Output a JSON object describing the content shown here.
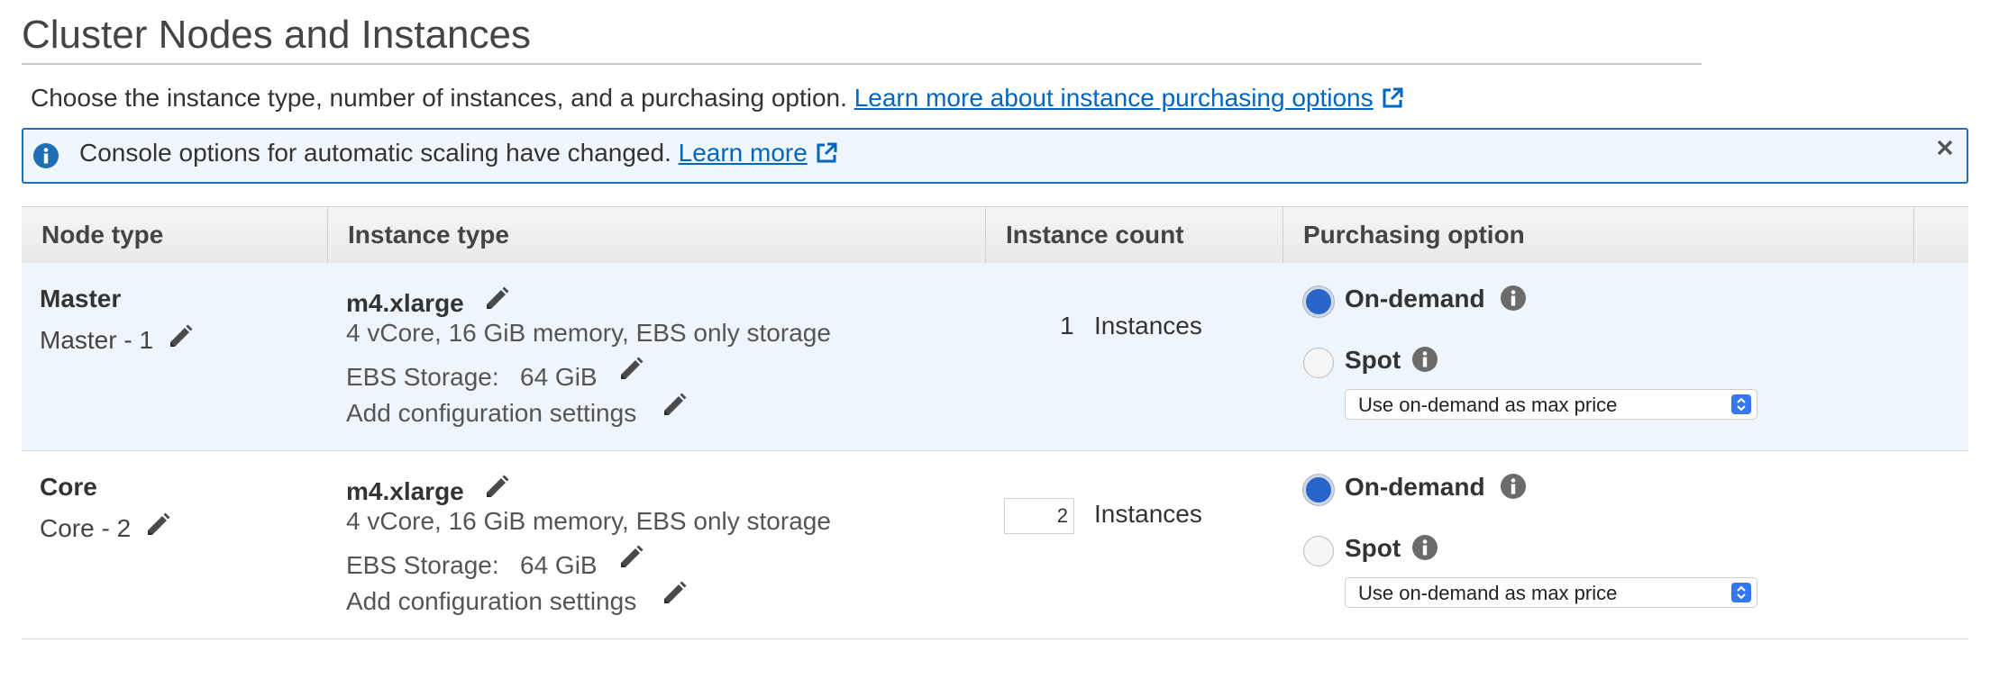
{
  "page": {
    "title": "Cluster Nodes and Instances",
    "description": "Choose the instance type, number of instances, and a purchasing option.",
    "description_link": "Learn more about instance purchasing options"
  },
  "info": {
    "text": "Console options for automatic scaling have changed.",
    "link": "Learn more"
  },
  "table": {
    "headers": [
      "Node type",
      "Instance type",
      "Instance count",
      "Purchasing option"
    ],
    "rows": [
      {
        "node_type": "Master",
        "node_name": "Master - 1",
        "instance_type": "m4.xlarge",
        "spec": "4 vCore, 16 GiB memory, EBS only storage",
        "ebs_label": "EBS Storage:",
        "ebs_value": "64 GiB",
        "config_label": "Add configuration settings",
        "count": "1",
        "count_unit": "Instances",
        "on_demand": "On-demand",
        "spot": "Spot",
        "max_price": "Use on-demand as max price"
      },
      {
        "node_type": "Core",
        "node_name": "Core - 2",
        "instance_type": "m4.xlarge",
        "spec": "4 vCore, 16 GiB memory, EBS only storage",
        "ebs_label": "EBS Storage:",
        "ebs_value": "64 GiB",
        "config_label": "Add configuration settings",
        "count": "2",
        "count_unit": "Instances",
        "on_demand": "On-demand",
        "spot": "Spot",
        "max_price": "Use on-demand as max price"
      }
    ]
  },
  "colors": {
    "link": "#0066c0",
    "info_border": "#1f6fb5",
    "info_bg": "#f0f7fc",
    "row_highlight": "#eef5fb",
    "radio_selected": "#2a66c9"
  }
}
